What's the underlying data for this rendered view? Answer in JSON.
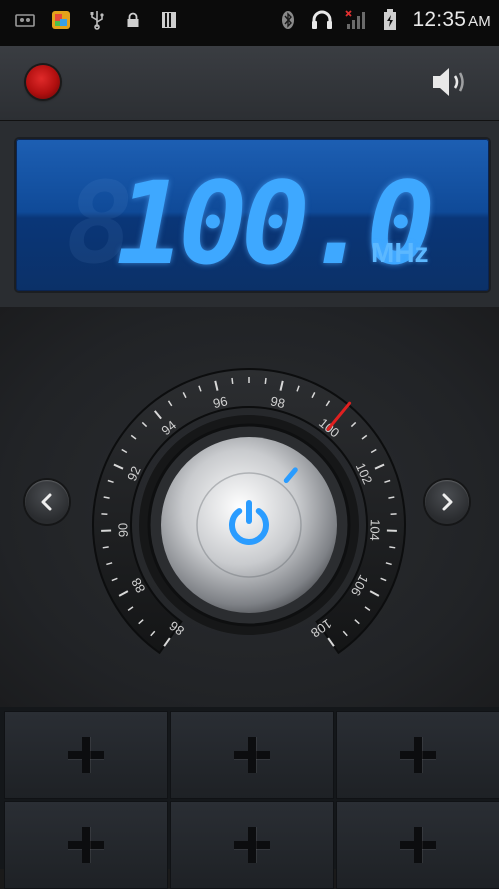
{
  "status_bar": {
    "time": "12:35",
    "ampm": "AM",
    "left_icons": [
      "cassette-icon",
      "photo-app-icon",
      "usb-icon",
      "lock-icon",
      "storage-icon"
    ],
    "right_icons": [
      "bluetooth-icon",
      "headphones-icon",
      "signal-icon",
      "battery-icon"
    ]
  },
  "toolbar": {
    "record_icon": "record-icon",
    "volume_icon": "speaker-volume-icon"
  },
  "display": {
    "frequency": "100.0",
    "ghost_digits": "8",
    "unit": "MHz"
  },
  "dial": {
    "tick_labels": [
      "86",
      "88",
      "90",
      "92",
      "94",
      "96",
      "98",
      "100",
      "102",
      "104",
      "106",
      "108"
    ],
    "current_frequency": 100.0,
    "range": [
      86,
      108
    ],
    "needle_color": "#e02020",
    "power_color": "#2a9cff"
  },
  "presets": {
    "slots": [
      "",
      "",
      "",
      "",
      "",
      ""
    ]
  },
  "colors": {
    "display_blue": "#0f4a98",
    "digit_blue": "#3ea8ff",
    "record_red": "#c81414"
  }
}
